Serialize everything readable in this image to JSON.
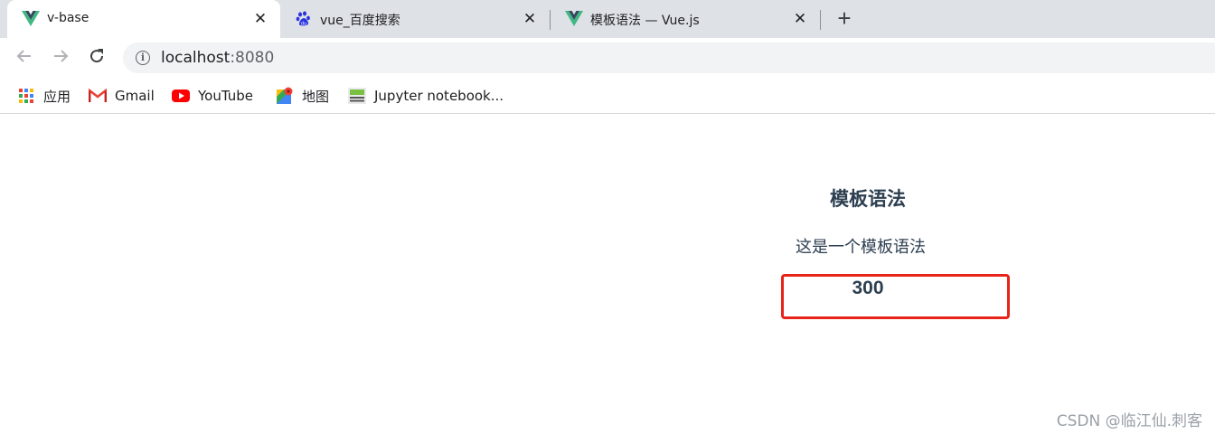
{
  "tabs": [
    {
      "title": "v-base",
      "icon": "vue-logo-icon",
      "active": true
    },
    {
      "title": "vue_百度搜索",
      "icon": "baidu-paw-icon",
      "active": false
    },
    {
      "title": "模板语法 — Vue.js",
      "icon": "vue-logo-icon",
      "active": false
    }
  ],
  "tab_close_glyph": "✕",
  "new_tab_glyph": "+",
  "omnibox": {
    "host": "localhost",
    "port": ":8080"
  },
  "bookmarks": [
    {
      "label": "应用",
      "icon": "apps-grid-icon"
    },
    {
      "label": "Gmail",
      "icon": "gmail-icon"
    },
    {
      "label": "YouTube",
      "icon": "youtube-icon"
    },
    {
      "label": "地图",
      "icon": "maps-pin-icon"
    },
    {
      "label": "Jupyter notebook...",
      "icon": "jupyter-icon"
    }
  ],
  "content": {
    "heading": "模板语法",
    "text": "这是一个模板语法",
    "value": "300"
  },
  "watermark": "CSDN @临江仙.刺客",
  "colors": {
    "tabstrip": "#dee1e6",
    "vue_green": "#41b883",
    "vue_dark": "#35495e",
    "text": "#2c3e50",
    "highlight": "#e8231a"
  }
}
